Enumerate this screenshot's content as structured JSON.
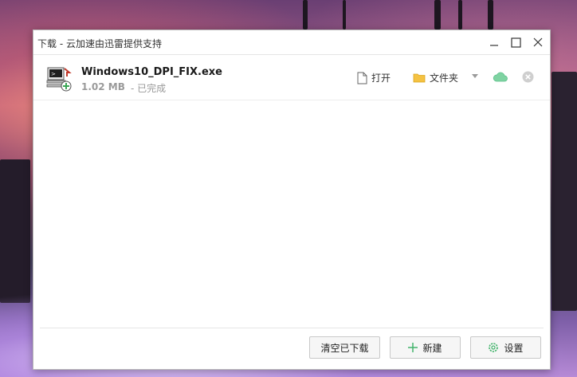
{
  "window": {
    "title": "下载 - 云加速由迅雷提供支持"
  },
  "download": {
    "file_name": "Windows10_DPI_FIX.exe",
    "size": "1.02 MB",
    "status": "- 已完成",
    "actions": {
      "open_label": "打开",
      "folder_label": "文件夹"
    }
  },
  "footer": {
    "clear_label": "清空已下载",
    "new_label": "新建",
    "settings_label": "设置"
  },
  "colors": {
    "cloud_accent": "#5cc08a",
    "folder": "#f5c242",
    "settings_accent": "#42b36b"
  }
}
